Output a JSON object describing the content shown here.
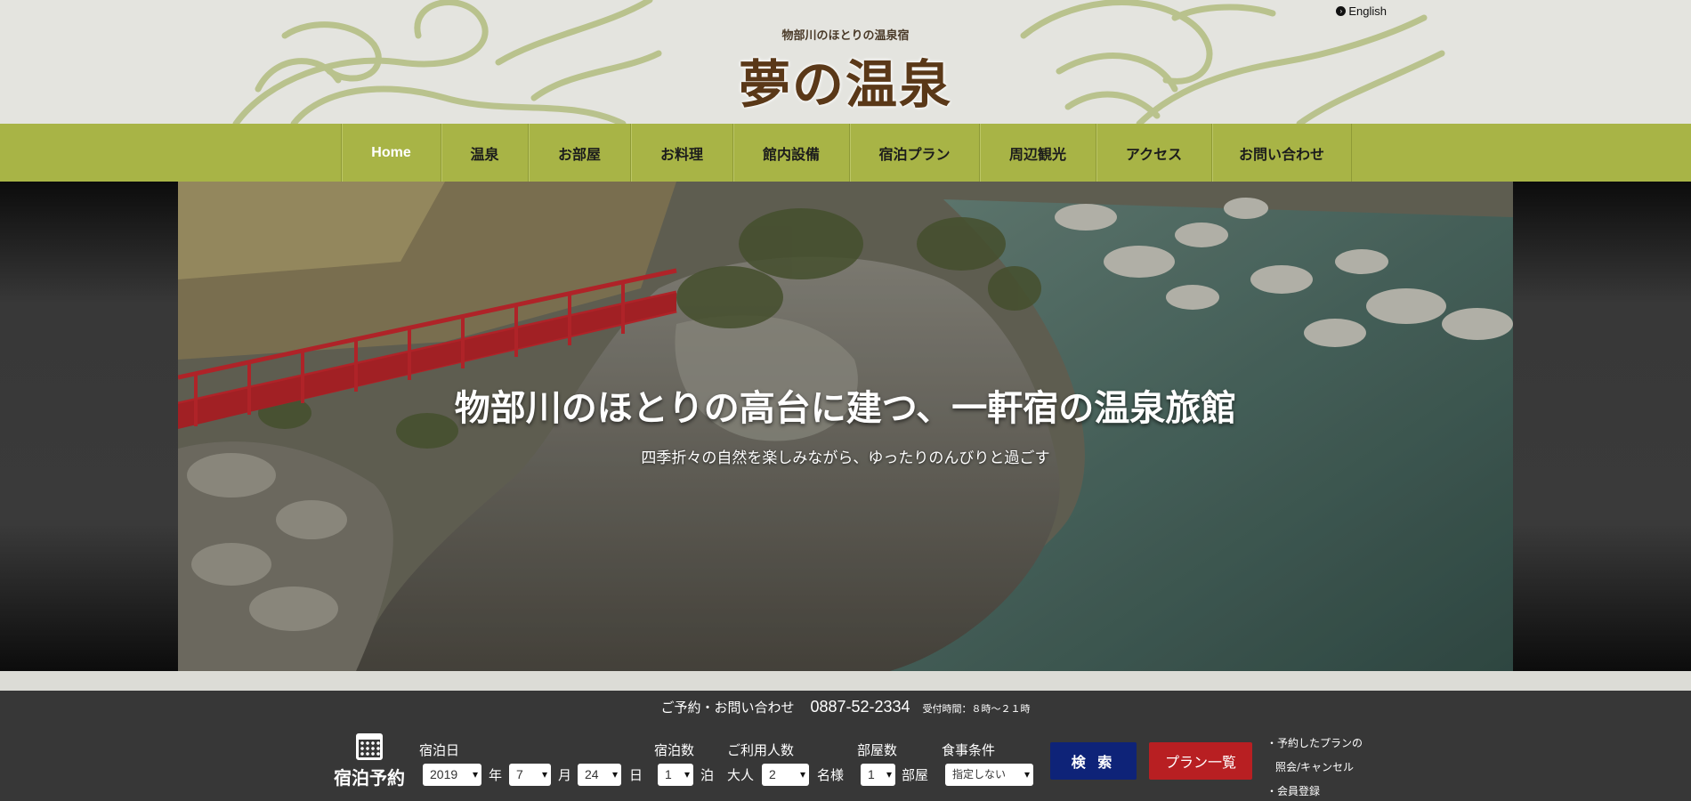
{
  "header": {
    "tagline": "物部川のほとりの温泉宿",
    "logo": "夢の温泉",
    "language_link": "English"
  },
  "nav": {
    "items": [
      "Home",
      "温泉",
      "お部屋",
      "お料理",
      "館内設備",
      "宿泊プラン",
      "周辺観光",
      "アクセス",
      "お問い合わせ"
    ],
    "active": "Home"
  },
  "hero": {
    "title": "物部川のほとりの高台に建つ、一軒宿の温泉旅館",
    "subtitle": "四季折々の自然を楽しみながら、ゆったりのんびりと過ごす"
  },
  "booking": {
    "contact_label": "ご予約・お問い合わせ",
    "phone": "0887-52-2334",
    "hours": "受付時間：８時～２１時",
    "title": "宿泊予約",
    "labels": {
      "date": "宿泊日",
      "nights": "宿泊数",
      "guests": "ご利用人数",
      "rooms": "部屋数",
      "meal": "食事条件"
    },
    "year": "2019",
    "year_unit": "年",
    "month": "7",
    "month_unit": "月",
    "day": "24",
    "day_unit": "日",
    "nights_value": "1",
    "nights_unit": "泊",
    "adult_label": "大人",
    "adults": "2",
    "adults_unit": "名様",
    "rooms_value": "1",
    "rooms_unit": "部屋",
    "meal_value": "指定しない",
    "search_button": "検 索",
    "plans_button": "プラン一覧",
    "links": [
      "・予約したプランの",
      "照会/キャンセル",
      "・会員登録"
    ]
  },
  "colors": {
    "nav_green": "#a8b446",
    "search_blue": "#0e2378",
    "plans_red": "#b81f22",
    "booking_bg": "#373737"
  }
}
